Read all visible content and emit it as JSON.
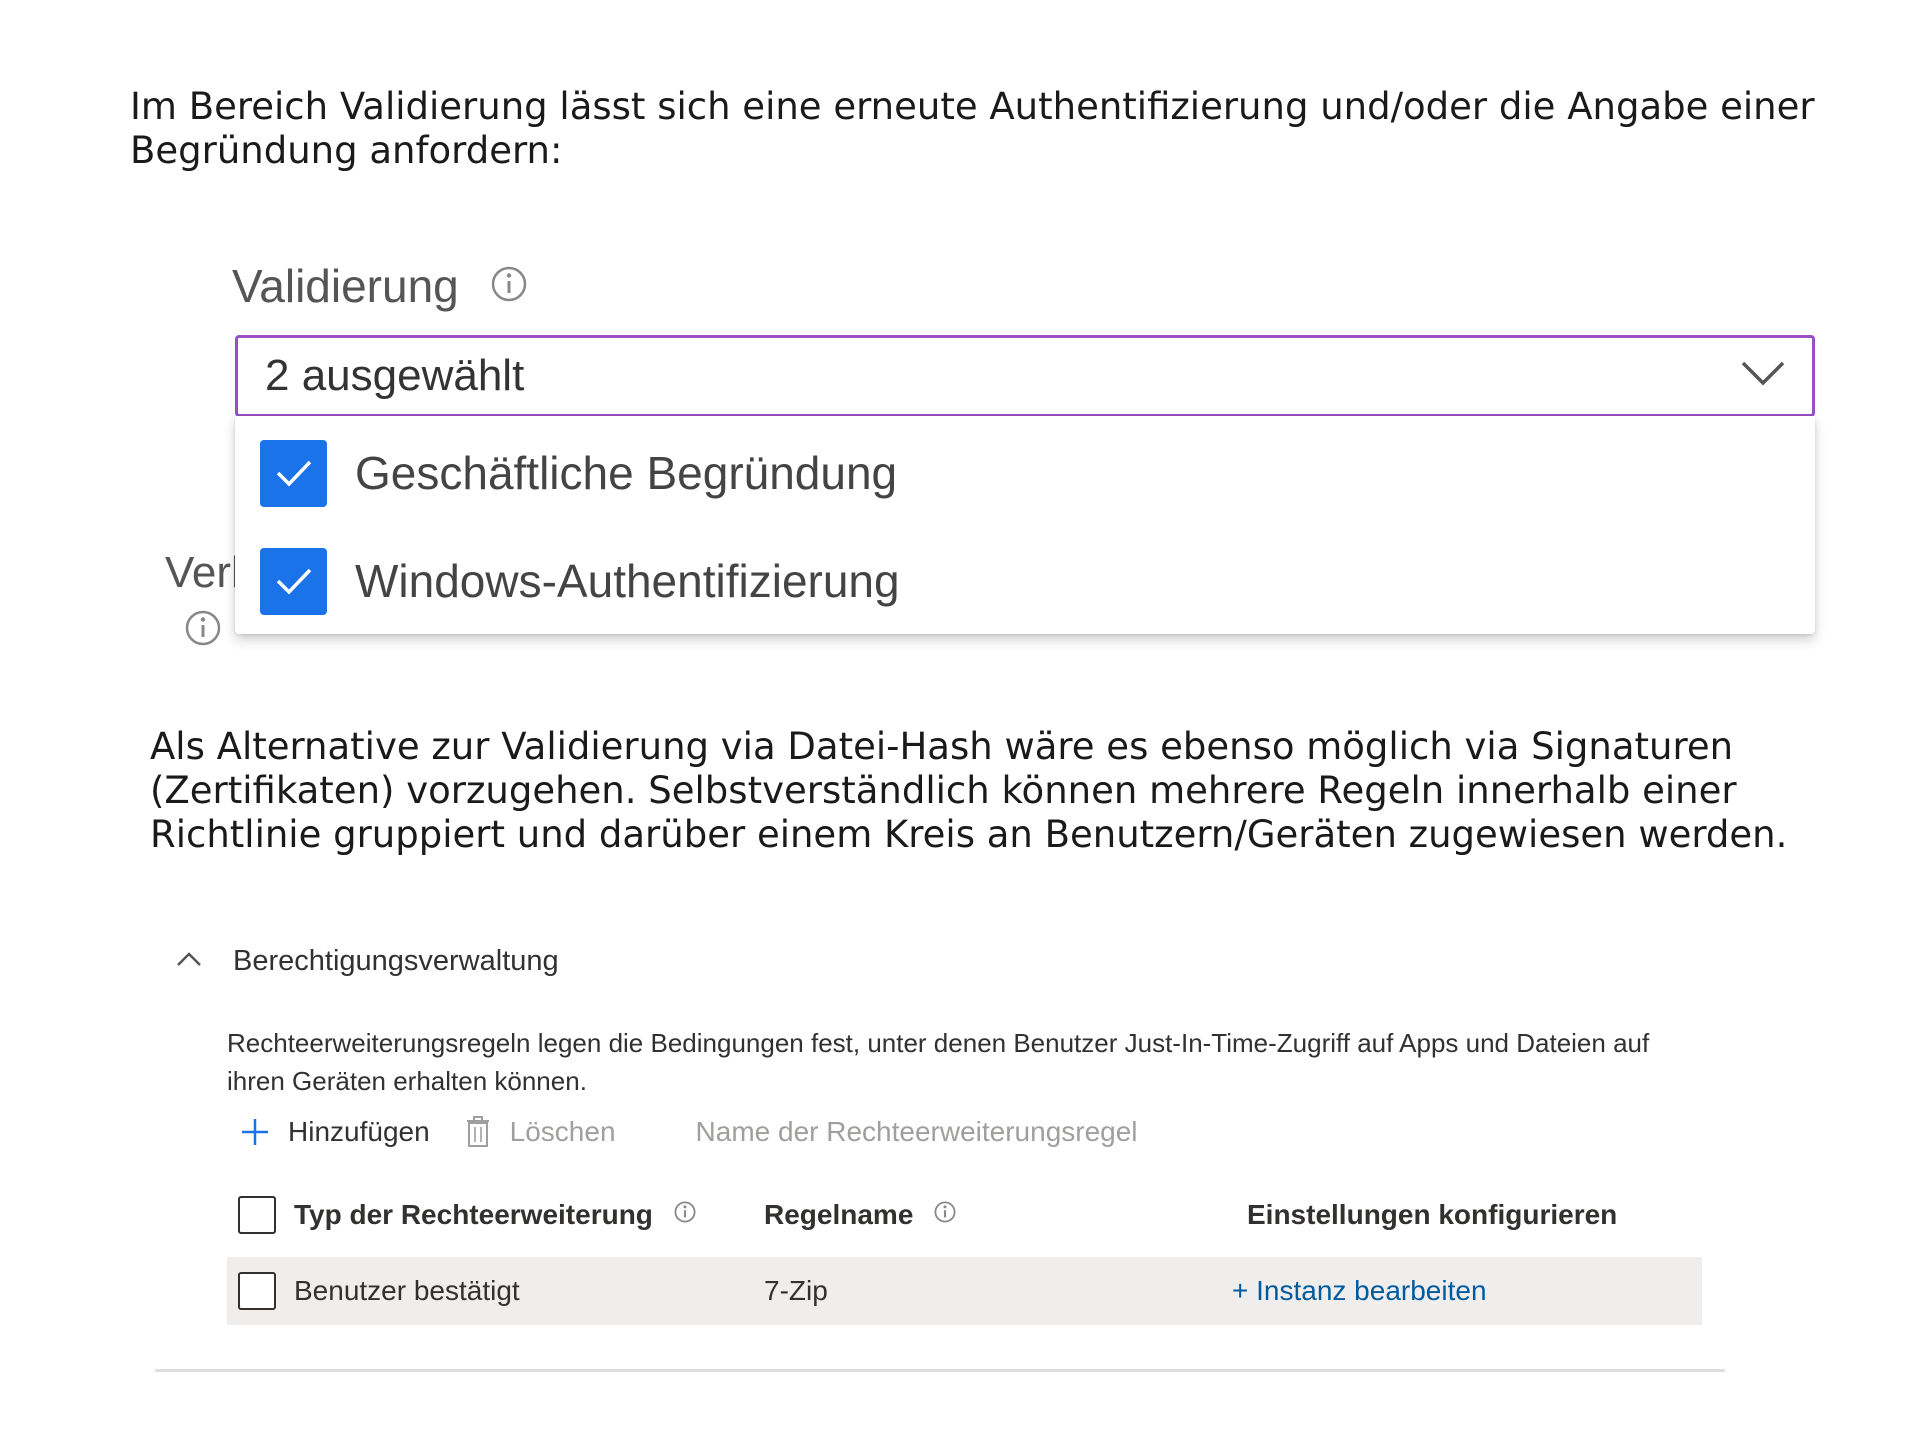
{
  "intro_text": "Im Bereich Validierung lässt sich eine erneute Authentifizierung und/oder die Angabe einer Begründung anfordern:",
  "validation": {
    "label": "Validierung",
    "selected_value": "2 ausgewählt",
    "options": [
      {
        "label": "Geschäftliche Begründung",
        "checked": true
      },
      {
        "label": "Windows-Authentifizierung",
        "checked": true
      }
    ],
    "hidden_field_label_fragment": "Verl"
  },
  "alternative_text": "Als Alternative zur Validierung via Datei-Hash wäre es ebenso möglich via Signaturen (Zertifikaten) vorzugehen. Selbstverständlich können mehrere Regeln innerhalb einer Richtlinie gruppiert und darüber einem Kreis an Benutzern/Geräten zugewiesen werden.",
  "permissions": {
    "section_title": "Berechtigungsverwaltung",
    "description": "Rechteerweiterungsregeln legen die Bedingungen fest, unter denen Benutzer Just-In-Time-Zugriff auf Apps und Dateien auf ihren Geräten erhalten können.",
    "toolbar": {
      "add_label": "Hinzufügen",
      "delete_label": "Löschen",
      "search_placeholder": "Name der Rechteerweiterungsregel"
    },
    "table": {
      "columns": [
        "Typ der Rechteerweiterung",
        "Regelname",
        "Einstellungen konfigurieren"
      ],
      "rows": [
        {
          "type": "Benutzer bestätigt",
          "rule_name": "7-Zip",
          "action": "+ Instanz bearbeiten"
        }
      ]
    }
  },
  "colors": {
    "select_border": "#9b4fc4",
    "checkbox_checked": "#1a73e8",
    "link": "#005a9e",
    "row_highlight": "#efeeed"
  }
}
